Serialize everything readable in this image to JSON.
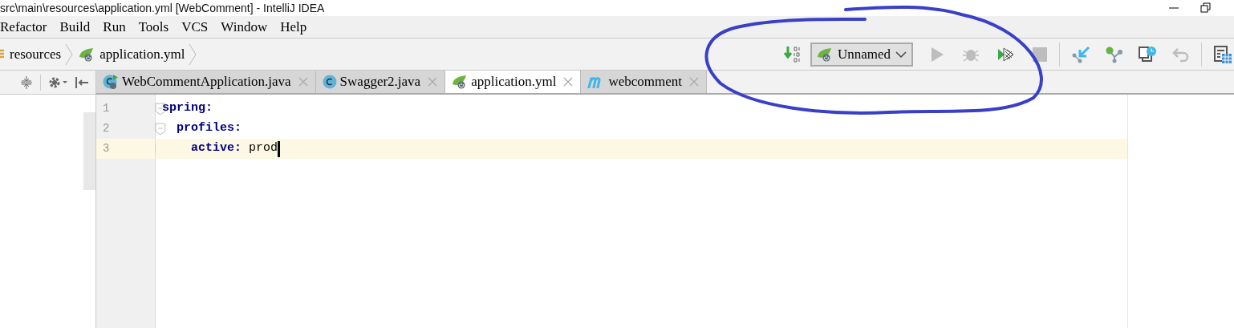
{
  "window": {
    "title": "src\\main\\resources\\application.yml [WebComment] - IntelliJ IDEA"
  },
  "menu": [
    {
      "label": "Refactor"
    },
    {
      "label": "Build"
    },
    {
      "label": "Run"
    },
    {
      "label": "Tools"
    },
    {
      "label": "VCS"
    },
    {
      "label": "Window"
    },
    {
      "label": "Help"
    }
  ],
  "breadcrumbs": [
    {
      "label": "resources",
      "kind": "folder"
    },
    {
      "label": "application.yml",
      "kind": "spring"
    }
  ],
  "toolbar": {
    "run_config": "Unnamed",
    "buttons": [
      {
        "kind": "build",
        "disabled": false
      },
      {
        "kind": "run",
        "disabled": true
      },
      {
        "kind": "debug",
        "disabled": true
      },
      {
        "kind": "coverage",
        "disabled": false
      },
      {
        "kind": "stop",
        "disabled": true
      },
      {
        "kind": "vcs-update",
        "disabled": false
      },
      {
        "kind": "vcs-commit",
        "disabled": false
      },
      {
        "kind": "history",
        "disabled": false
      },
      {
        "kind": "revert",
        "disabled": true
      },
      {
        "kind": "structure",
        "disabled": false
      }
    ]
  },
  "tabs": [
    {
      "label": "WebCommentApplication.java",
      "kind": "spring-class",
      "selected": false
    },
    {
      "label": "Swagger2.java",
      "kind": "class",
      "selected": false
    },
    {
      "label": "application.yml",
      "kind": "spring",
      "selected": true
    },
    {
      "label": "webcomment",
      "kind": "maven",
      "selected": false
    }
  ],
  "editor": {
    "lines": [
      {
        "number": "1",
        "key": "spring:",
        "current": false
      },
      {
        "number": "2",
        "key": "  profiles:",
        "current": false
      },
      {
        "number": "3",
        "key": "    active:",
        "value": " prod",
        "current": true
      }
    ]
  }
}
